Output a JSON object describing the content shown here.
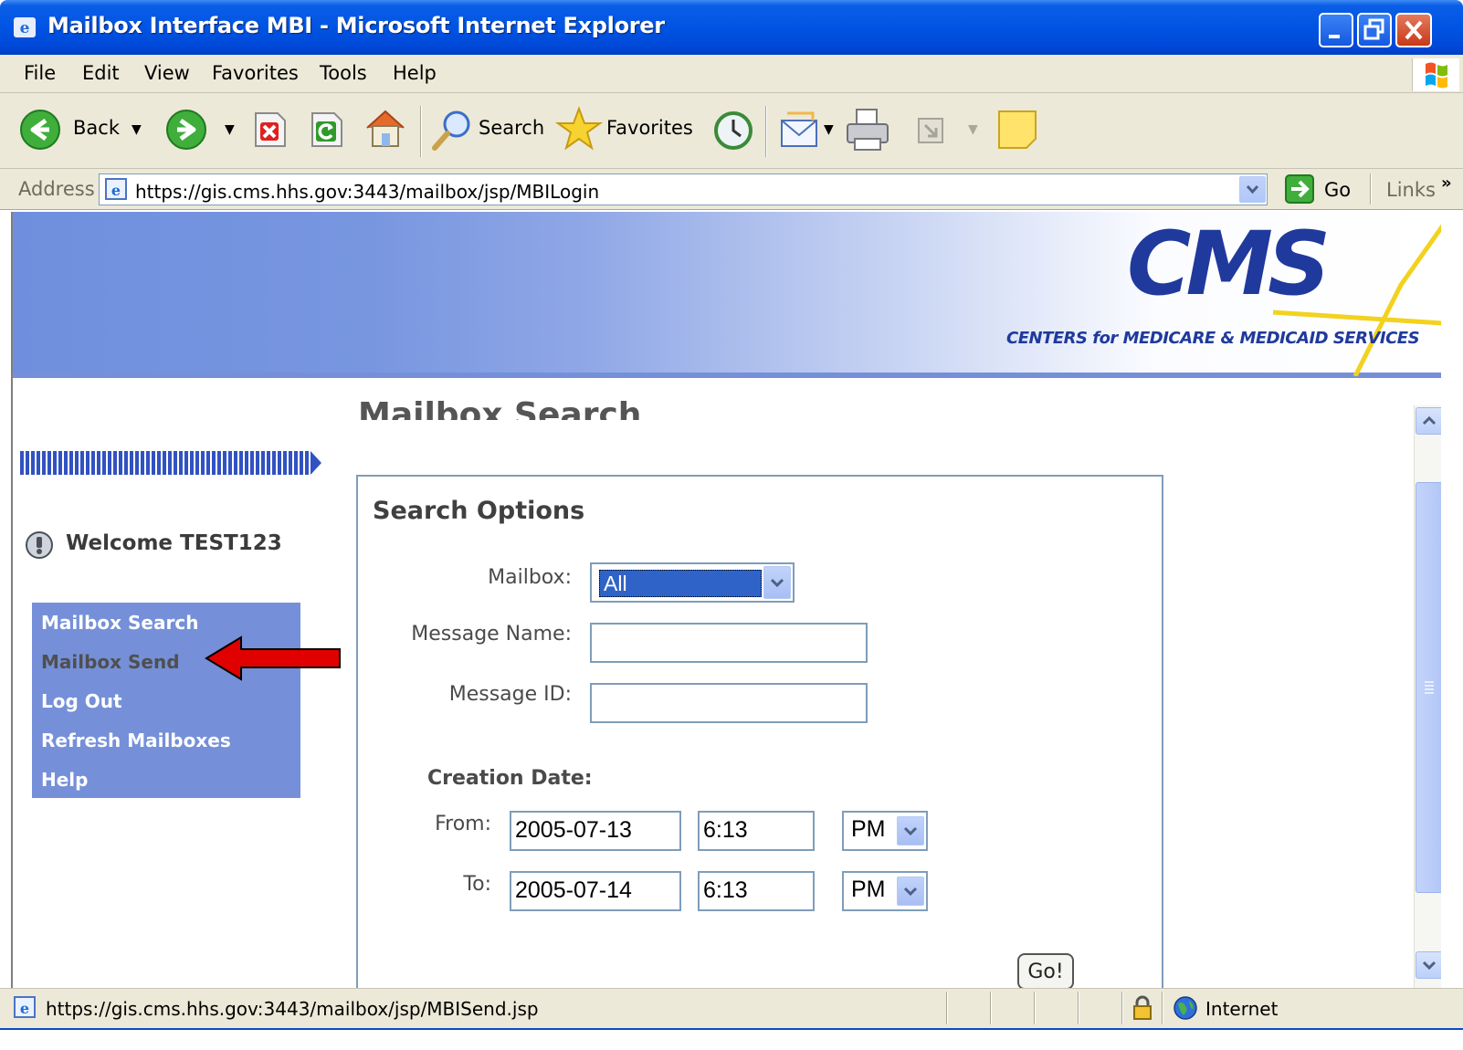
{
  "window": {
    "title": "Mailbox Interface MBI - Microsoft Internet Explorer"
  },
  "menu": [
    "File",
    "Edit",
    "View",
    "Favorites",
    "Tools",
    "Help"
  ],
  "toolbar": {
    "back_label": "Back",
    "search_label": "Search",
    "favorites_label": "Favorites"
  },
  "address": {
    "label": "Address",
    "url": "https://gis.cms.hhs.gov:3443/mailbox/jsp/MBILogin",
    "go_label": "Go",
    "links_label": "Links",
    "more_label": "»"
  },
  "banner": {
    "logo_text": "CMS",
    "logo_subtitle": "CENTERS for MEDICARE & MEDICAID SERVICES"
  },
  "page": {
    "heading": "Mailbox Search",
    "welcome": "Welcome TEST123"
  },
  "nav": {
    "items": [
      "Mailbox Search",
      "Mailbox Send",
      "Log Out",
      "Refresh Mailboxes",
      "Help"
    ]
  },
  "search": {
    "title": "Search Options",
    "mailbox_label": "Mailbox:",
    "mailbox_value": "All",
    "message_name_label": "Message Name:",
    "message_name_value": "",
    "message_id_label": "Message ID:",
    "message_id_value": "",
    "creation_date_label": "Creation Date:",
    "from_label": "From:",
    "from_date": "2005-07-13",
    "from_time": "6:13",
    "from_ampm": "PM",
    "to_label": "To:",
    "to_date": "2005-07-14",
    "to_time": "6:13",
    "to_ampm": "PM",
    "go_button": "Go!"
  },
  "status": {
    "url": "https://gis.cms.hhs.gov:3443/mailbox/jsp/MBISend.jsp",
    "zone": "Internet"
  },
  "colors": {
    "titlebar": "#0054e3",
    "nav_background": "#7590d8",
    "selected_option": "#3063c7",
    "annotation_arrow": "#e00000",
    "cms_blue": "#1f3a9c",
    "cms_yellow": "#f2d21e"
  }
}
